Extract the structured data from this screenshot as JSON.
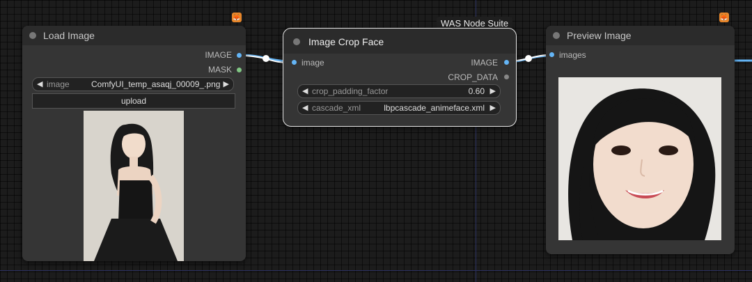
{
  "nodes": {
    "load_image": {
      "title": "Load Image",
      "outputs": [
        "IMAGE",
        "MASK"
      ],
      "widget_label": "image",
      "widget_value": "ComfyUI_temp_asaqj_00009_.png",
      "upload_label": "upload"
    },
    "crop_face": {
      "title": "Image Crop Face",
      "badge": "WAS Node Suite",
      "input": "image",
      "outputs": [
        "IMAGE",
        "CROP_DATA"
      ],
      "widgets": [
        {
          "label": "crop_padding_factor",
          "value": "0.60"
        },
        {
          "label": "cascade_xml",
          "value": "lbpcascade_animeface.xml"
        }
      ]
    },
    "preview": {
      "title": "Preview Image",
      "input": "images"
    }
  },
  "glyphs": {
    "left": "◀",
    "right": "▶",
    "fox": "🦊"
  },
  "colors": {
    "image_slot": "#64b5f6",
    "mask_slot": "#81c784",
    "link": "#64b5f6"
  }
}
